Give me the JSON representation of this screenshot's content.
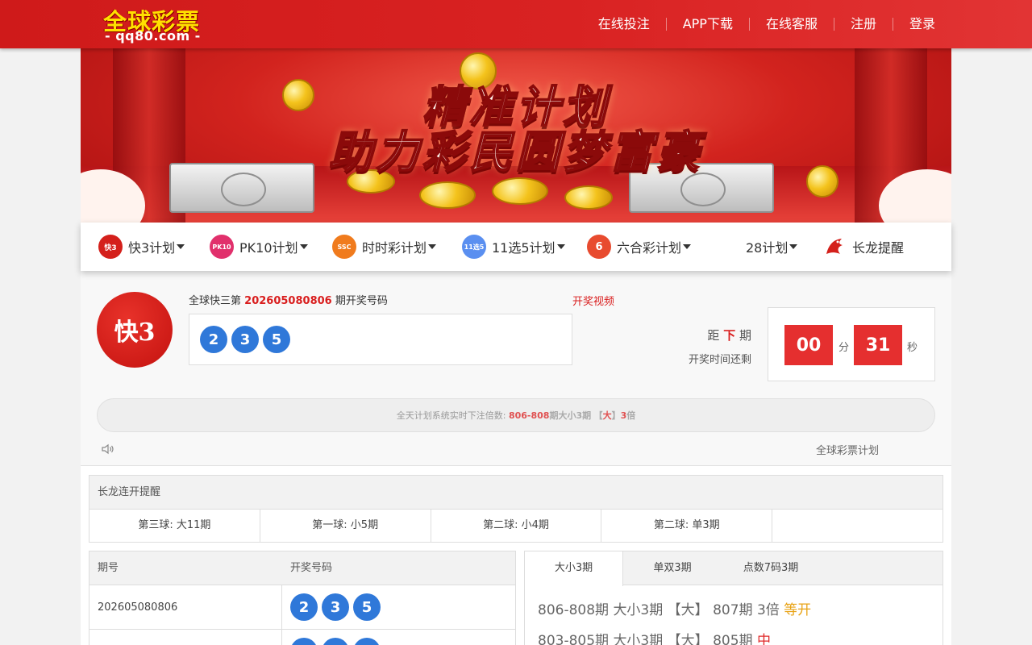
{
  "header": {
    "logo_brand": "全球彩票",
    "logo_domain": "- qq80.com -",
    "nav": [
      "在线投注",
      "APP下载",
      "在线客服",
      "注册",
      "登录"
    ]
  },
  "banner": {
    "line1": "精准计划",
    "line2": "助力彩民圆梦富豪"
  },
  "games": [
    {
      "label": "快3计划",
      "icon": "k3-icon",
      "icon_text": "快3",
      "color": "#d4201b",
      "dropdown": true
    },
    {
      "label": "PK10计划",
      "icon": "pk10-icon",
      "icon_text": "PK10",
      "color": "#e1306c",
      "dropdown": true
    },
    {
      "label": "时时彩计划",
      "icon": "ssc-icon",
      "icon_text": "SSC",
      "color": "#f07b1d",
      "dropdown": true
    },
    {
      "label": "11选5计划",
      "icon": "11x5-icon",
      "icon_text": "11选5",
      "color": "#5a8ff0",
      "dropdown": true
    },
    {
      "label": "六合彩计划",
      "icon": "lhc-icon",
      "icon_text": "6",
      "color": "#e84b2f",
      "dropdown": true
    },
    {
      "label": "28计划",
      "icon": "",
      "icon_text": "",
      "color": "",
      "dropdown": true
    },
    {
      "label": "长龙提醒",
      "icon": "dragon-icon",
      "icon_text": "",
      "color": "#d4201b",
      "dropdown": false
    }
  ],
  "draw": {
    "logo_text": "快3",
    "title_prefix": "全球快三第",
    "period": "202605080806",
    "title_suffix": "期开奖号码",
    "balls": [
      "2",
      "3",
      "5"
    ],
    "video_link": "开奖视频",
    "next_prefix": "距",
    "next_mark": "下",
    "next_suffix": "期",
    "remain_label": "开奖时间还剩",
    "minutes": "00",
    "minutes_unit": "分",
    "seconds": "31",
    "seconds_unit": "秒"
  },
  "notice": {
    "prefix": "全天计划系统实时下注倍数:",
    "range": "806-808",
    "mid": "期大小3期",
    "bracket_open": "【",
    "pick": "大",
    "bracket_close": "】",
    "mult": "3",
    "suffix": "倍"
  },
  "plan_label": "全球彩票计划",
  "dragon": {
    "title": "长龙连开提醒",
    "cells": [
      "第三球: 大11期",
      "第一球: 小5期",
      "第二球: 小4期",
      "第二球: 单3期",
      ""
    ]
  },
  "history": {
    "headers": [
      "期号",
      "开奖号码"
    ],
    "rows": [
      {
        "period": "202605080806",
        "balls": [
          "2",
          "3",
          "5"
        ]
      },
      {
        "period": "",
        "balls": [
          "",
          "",
          ""
        ]
      }
    ]
  },
  "plans": {
    "tabs": [
      "大小3期",
      "单双3期",
      "点数7码3期"
    ],
    "active_tab": 0,
    "lines": [
      {
        "range": "806-808期",
        "kind": "大小3期",
        "pick": "【大】",
        "current": "807期",
        "mult": "3倍",
        "status": "等开",
        "status_color": "#e8a316"
      },
      {
        "range": "803-805期",
        "kind": "大小3期",
        "pick": "【大】",
        "current": "805期",
        "mult": "",
        "status": "中",
        "status_color": "#e02a2a"
      }
    ]
  },
  "colors": {
    "brand_red": "#d91e1e",
    "ball_blue": "#2f78d9",
    "timer_red": "#e52f2f"
  }
}
